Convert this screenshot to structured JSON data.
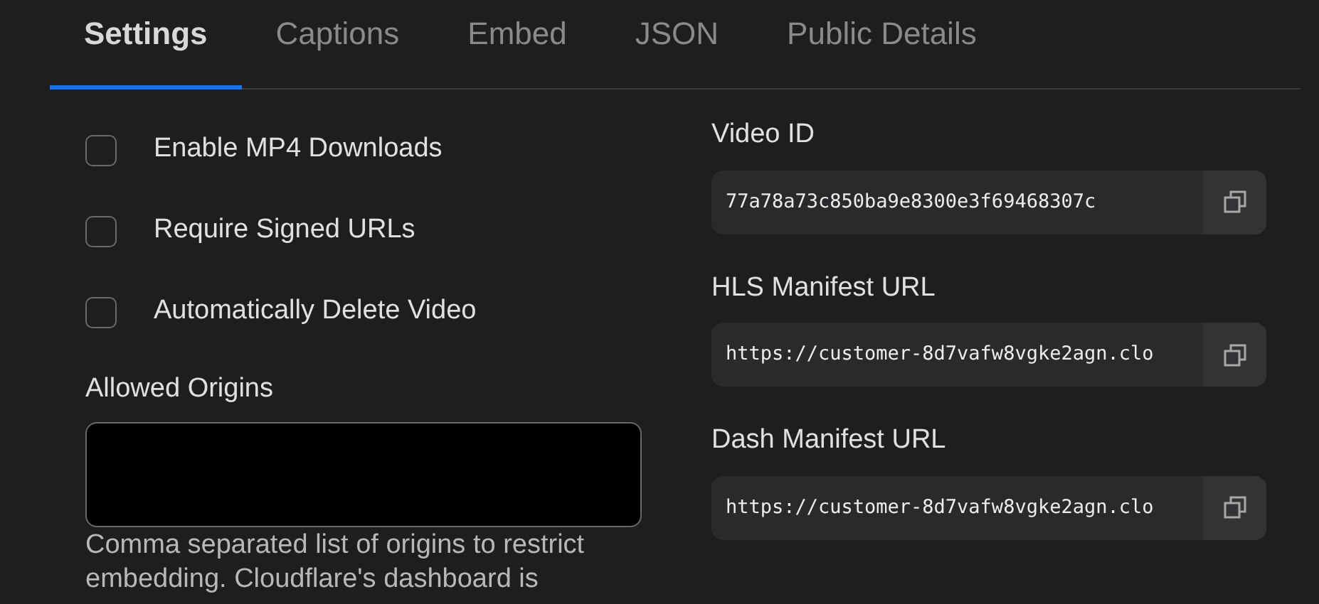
{
  "tabs": [
    {
      "label": "Settings",
      "selected": true
    },
    {
      "label": "Captions",
      "selected": false
    },
    {
      "label": "Embed",
      "selected": false
    },
    {
      "label": "JSON",
      "selected": false
    },
    {
      "label": "Public Details",
      "selected": false
    }
  ],
  "options": [
    {
      "label": "Enable MP4 Downloads",
      "checked": false
    },
    {
      "label": "Require Signed URLs",
      "checked": false
    },
    {
      "label": "Automatically Delete Video",
      "checked": false
    }
  ],
  "allowed_origins": {
    "label": "Allowed Origins",
    "help": "Comma separated list of origins to restrict embedding. Cloudflare's dashboard is"
  },
  "fields": [
    {
      "label": "Video ID",
      "value": "77a78a73c850ba9e8300e3f69468307c"
    },
    {
      "label": "HLS Manifest URL",
      "value": "https://customer-8d7vafw8vgke2agn.clo"
    },
    {
      "label": "Dash Manifest URL",
      "value": "https://customer-8d7vafw8vgke2agn.clo"
    }
  ]
}
